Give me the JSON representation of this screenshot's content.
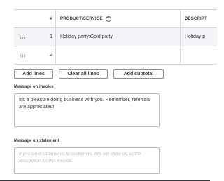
{
  "table": {
    "headers": {
      "num": "#",
      "product": "PRODUCT/SERVICE",
      "description": "DESCRIPT"
    },
    "rows": [
      {
        "num": "1",
        "product": "Holiday party:Gold party",
        "description": "Holiday p"
      },
      {
        "num": "2",
        "product": "",
        "description": ""
      }
    ]
  },
  "buttons": {
    "add_lines": "Add lines",
    "clear_all_lines": "Clear all lines",
    "add_subtotal": "Add subtotal"
  },
  "message_invoice": {
    "label": "Message on invoice",
    "value": "It's a pleasure doing business with you.  Remember, referrals are appreciated!"
  },
  "message_statement": {
    "label": "Message on statement",
    "placeholder": "If you send statements to customers, this will show up as the description for this invoice."
  },
  "icons": {
    "help": "help-circle-icon",
    "drag": "drag-handle-icon"
  },
  "colors": {
    "border": "#d4d7dc",
    "row_highlight": "#f4f5f8",
    "text": "#393a3d",
    "placeholder": "#b3b5ba"
  }
}
